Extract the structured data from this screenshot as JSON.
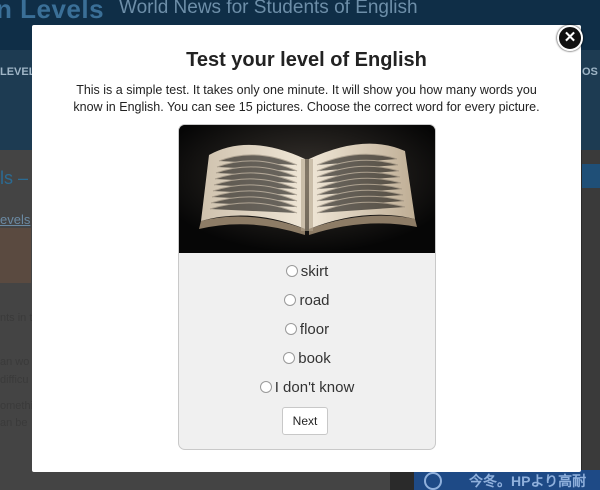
{
  "background": {
    "site_logo": "n Levels",
    "tagline": "World News for Students of English",
    "nav_left": "LEVEL",
    "nav_right": "OS",
    "article_title": "ls –",
    "article_link": "evels",
    "text_lines": [
      "nts in t",
      "an wo",
      "difficu",
      "omethi",
      "an be"
    ],
    "ad_text": "今冬。HPより高耐"
  },
  "modal": {
    "title": "Test your level of English",
    "description": "This is a simple test. It takes only one minute. It will show you how many words you know in English. You can see 15 pictures. Choose the correct word for every picture.",
    "close_symbol": "✕",
    "image_subject": "open book",
    "options": [
      {
        "label": "skirt"
      },
      {
        "label": "road"
      },
      {
        "label": "floor"
      },
      {
        "label": "book"
      },
      {
        "label": "I don't know"
      }
    ],
    "next_label": "Next"
  }
}
